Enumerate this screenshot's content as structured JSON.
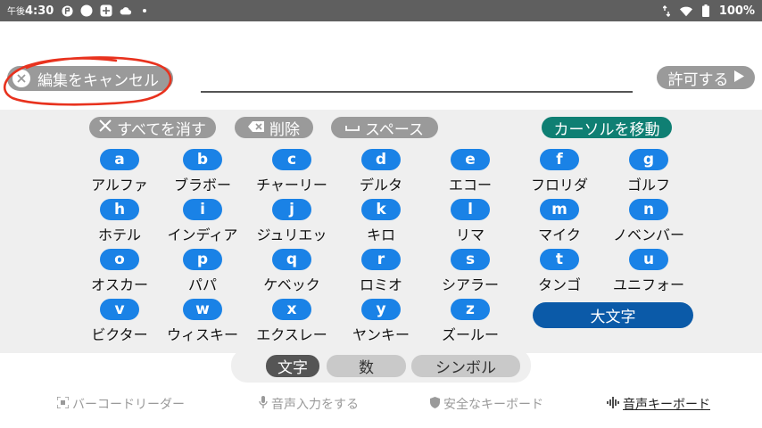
{
  "status_bar": {
    "ampm": "午後",
    "time": "4:30",
    "battery": "100%",
    "icons": [
      "app-icon",
      "circle-icon",
      "cast-icon",
      "cloud-icon",
      "dot-icon"
    ],
    "right_icons": [
      "data-arrows-icon",
      "wifi-icon",
      "battery-icon"
    ]
  },
  "top": {
    "cancel_label": "編集をキャンセル",
    "input_value": "",
    "allow_label": "許可する"
  },
  "actions": {
    "clear_all": "すべてを消す",
    "delete": "削除",
    "space": "スペース",
    "move_cursor": "カーソルを移動"
  },
  "keys": [
    {
      "letter": "a",
      "word": "アルファ"
    },
    {
      "letter": "b",
      "word": "ブラボー"
    },
    {
      "letter": "c",
      "word": "チャーリー"
    },
    {
      "letter": "d",
      "word": "デルタ"
    },
    {
      "letter": "e",
      "word": "エコー"
    },
    {
      "letter": "f",
      "word": "フロリダ"
    },
    {
      "letter": "g",
      "word": "ゴルフ"
    },
    {
      "letter": "h",
      "word": "ホテル"
    },
    {
      "letter": "i",
      "word": "インディア"
    },
    {
      "letter": "j",
      "word": "ジュリエッ"
    },
    {
      "letter": "k",
      "word": "キロ"
    },
    {
      "letter": "l",
      "word": "リマ"
    },
    {
      "letter": "m",
      "word": "マイク"
    },
    {
      "letter": "n",
      "word": "ノベンバー"
    },
    {
      "letter": "o",
      "word": "オスカー"
    },
    {
      "letter": "p",
      "word": "パパ"
    },
    {
      "letter": "q",
      "word": "ケベック"
    },
    {
      "letter": "r",
      "word": "ロミオ"
    },
    {
      "letter": "s",
      "word": "シアラー"
    },
    {
      "letter": "t",
      "word": "タンゴ"
    },
    {
      "letter": "u",
      "word": "ユニフォー"
    },
    {
      "letter": "v",
      "word": "ビクター"
    },
    {
      "letter": "w",
      "word": "ウィスキー"
    },
    {
      "letter": "x",
      "word": "エクスレー"
    },
    {
      "letter": "y",
      "word": "ヤンキー"
    },
    {
      "letter": "z",
      "word": "ズールー"
    }
  ],
  "caps_label": "大文字",
  "mode_tabs": {
    "letters": "文字",
    "numbers": "数",
    "symbols": "シンボル",
    "active": "letters"
  },
  "bottom_links": {
    "barcode": "バーコードリーダー",
    "voice_input": "音声入力をする",
    "secure_keyboard": "安全なキーボード",
    "voice_keyboard": "音声キーボード"
  },
  "colors": {
    "status_bar": "#5f5f5f",
    "key_blue": "#1a82e6",
    "caps_blue": "#0b5aa8",
    "move_cursor_teal": "#0f7f73",
    "gray_button": "#9a9a9a",
    "annotation_red": "#e8321e"
  }
}
